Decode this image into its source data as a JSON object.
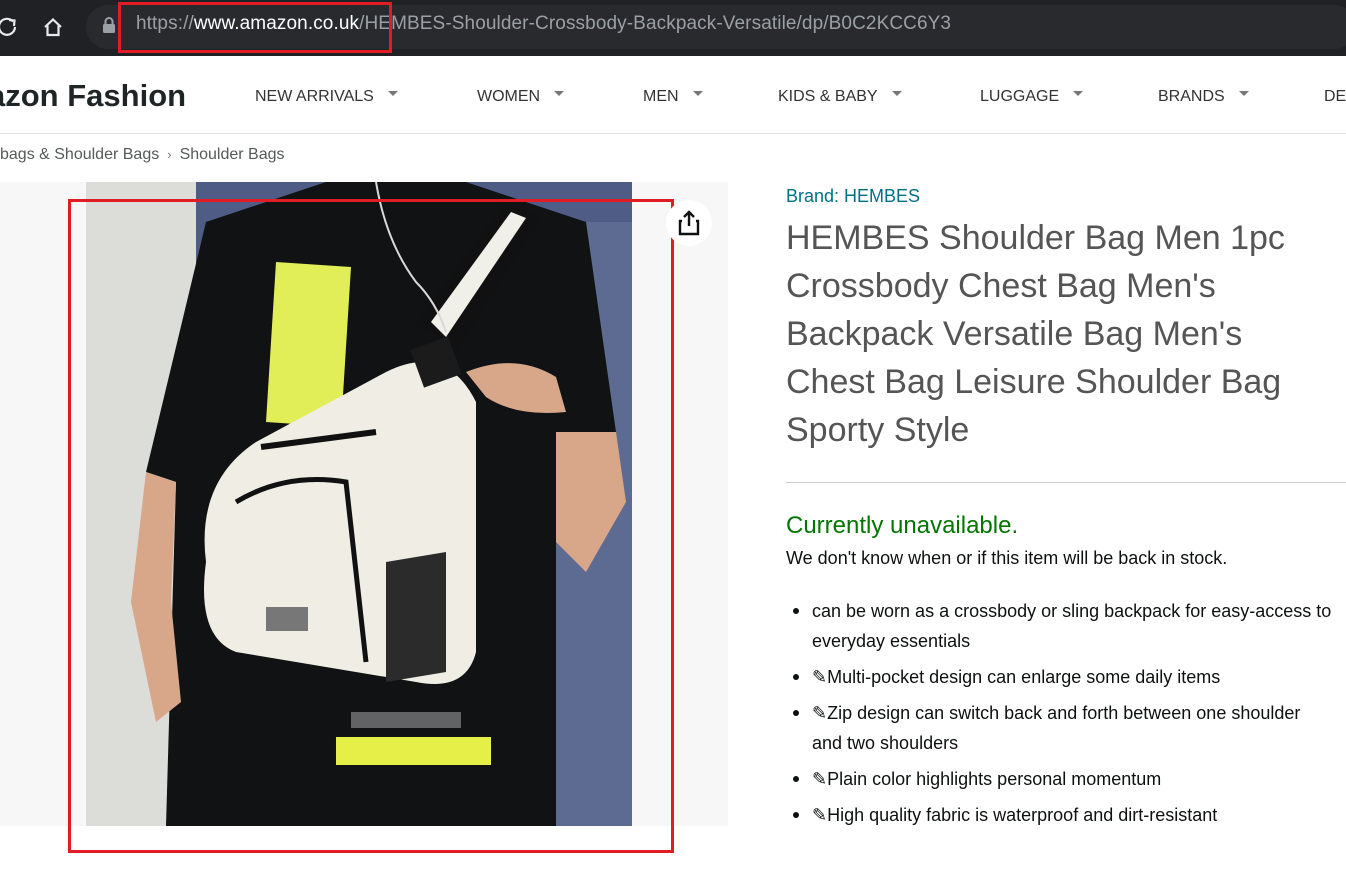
{
  "browser": {
    "url_scheme": "https://",
    "url_host": "www.amazon.co.uk",
    "url_path": "/HEMBES-Shoulder-Crossbody-Backpack-Versatile/dp/B0C2KCC6Y3"
  },
  "store": {
    "logo_text": "azon Fashion",
    "nav": [
      {
        "label": "NEW ARRIVALS"
      },
      {
        "label": "WOMEN"
      },
      {
        "label": "MEN"
      },
      {
        "label": "KIDS & BABY"
      },
      {
        "label": "LUGGAGE"
      },
      {
        "label": "BRANDS"
      },
      {
        "label": "DE"
      }
    ]
  },
  "breadcrumb": {
    "items": [
      "bags & Shoulder Bags",
      "Shoulder Bags"
    ],
    "separator": "›"
  },
  "product": {
    "brand_link": "Brand: HEMBES",
    "title": "HEMBES Shoulder Bag Men 1pc Crossbody Chest Bag Men's Backpack Versatile Bag Men's Chest Bag Leisure Shoulder Bag Sporty Style",
    "availability": "Currently unavailable.",
    "stock_note": "We don't know when or if this item will be back in stock.",
    "bullets": [
      "can be worn as a crossbody or sling backpack for easy-access to everyday essentials",
      "✎Multi-pocket design can enlarge some daily items",
      "✎Zip design can switch back and forth between one shoulder and two shoulders",
      "✎Plain color highlights personal momentum",
      "✎High quality fabric is waterproof and dirt-resistant"
    ]
  },
  "icons": {
    "reload": "reload-icon",
    "home": "home-icon",
    "lock": "lock-icon",
    "share": "share-icon"
  },
  "colors": {
    "brand_link": "#007185",
    "availability": "#007600",
    "highlight_box": "#e21c24",
    "browser_bg": "#202124"
  }
}
